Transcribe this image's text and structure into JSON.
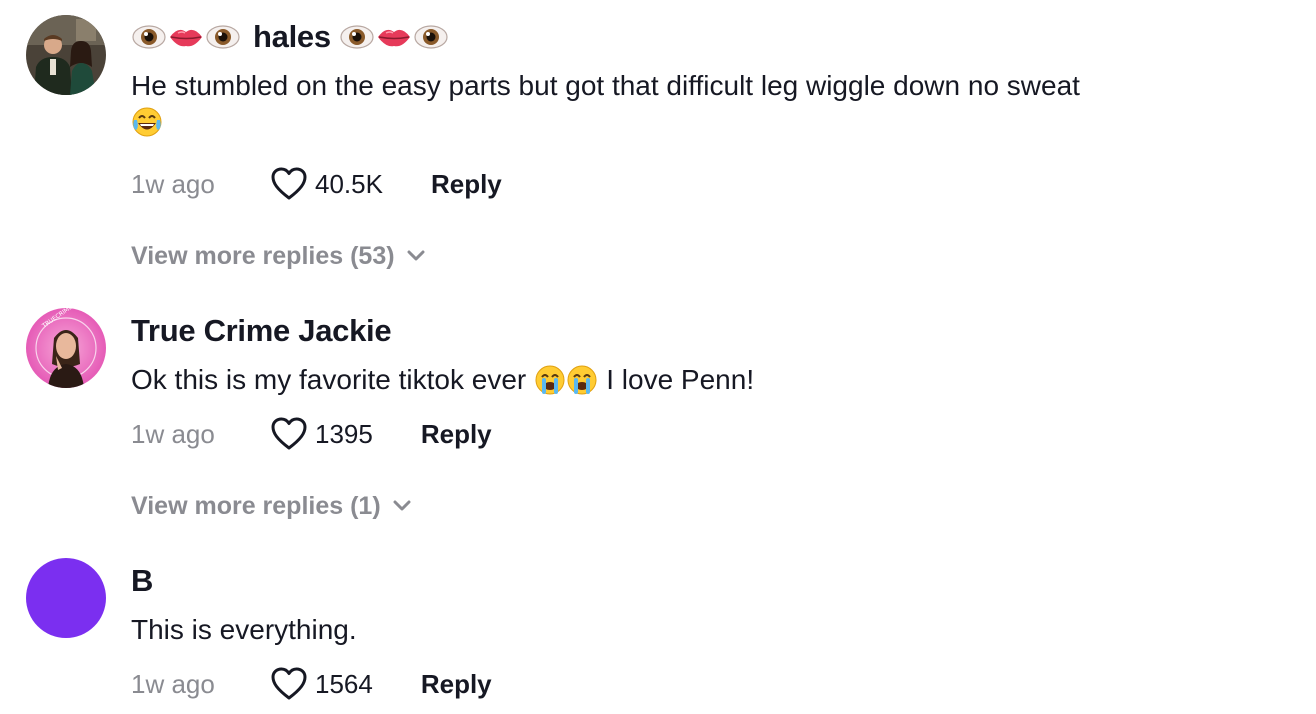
{
  "comments": [
    {
      "username": "hales",
      "username_prefix_emoji": "eye-lips-eye-icons",
      "username_suffix_emoji": "eye-lips-eye-icons",
      "text": "He stumbled on the easy parts but got that difficult leg wiggle down no sweat",
      "text_emoji": "tears-of-joy-icon",
      "time": "1w ago",
      "likes": "40.5K",
      "reply_label": "Reply",
      "view_more": "View more replies (53)"
    },
    {
      "username": "True Crime Jackie",
      "text_before_emoji": "Ok this is my favorite tiktok ever",
      "text_emoji": "loudly-crying-face-icon x2",
      "text_after_emoji": "I love Penn!",
      "time": "1w ago",
      "likes": "1395",
      "reply_label": "Reply",
      "view_more": "View more replies (1)"
    },
    {
      "username": "B",
      "text": "This is everything.",
      "time": "1w ago",
      "likes": "1564",
      "reply_label": "Reply",
      "avatar_color": "#7b2ff0"
    }
  ],
  "colors": {
    "secondary_text": "#8a8b91",
    "primary_text": "#161823"
  }
}
